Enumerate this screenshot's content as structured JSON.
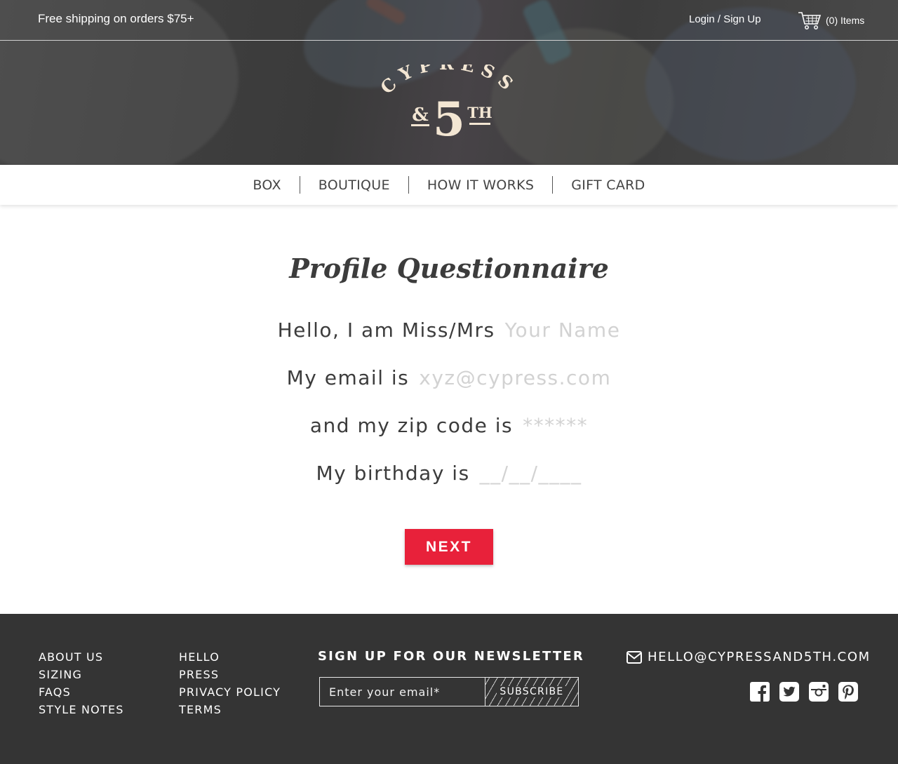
{
  "header": {
    "promo": "Free shipping on orders $75+",
    "login": "Login / Sign Up",
    "cart_count": "(0) Items"
  },
  "logo": {
    "top": "CYPRESS",
    "amp": "&",
    "five": "5",
    "th": "TH"
  },
  "nav": {
    "items": [
      "BOX",
      "BOUTIQUE",
      "HOW IT WORKS",
      "GIFT CARD"
    ]
  },
  "form": {
    "title": "Profile Questionnaire",
    "fields": [
      {
        "label": "Hello, I am Miss/Mrs",
        "placeholder": "Your Name"
      },
      {
        "label": "My email is",
        "placeholder": "xyz@cypress.com"
      },
      {
        "label": "and my zip code is",
        "placeholder": "******"
      },
      {
        "label": "My birthday is",
        "placeholder": "__/__/____"
      }
    ],
    "next_label": "NEXT"
  },
  "footer": {
    "col1": [
      "ABOUT US",
      "SIZING",
      "FAQS",
      "STYLE NOTES"
    ],
    "col2": [
      "HELLO",
      "PRESS",
      "PRIVACY POLICY",
      "TERMS"
    ],
    "newsletter_title": "SIGN UP FOR OUR NEWSLETTER",
    "newsletter_placeholder": "Enter your email*",
    "subscribe_label": "SUBSCRIBE",
    "email": "HELLO@CYPRESSAND5TH.COM",
    "social_icons": [
      "facebook-icon",
      "twitter-icon",
      "instagram-icon",
      "pinterest-icon"
    ]
  },
  "colors": {
    "accent": "#e8213a",
    "footer_bg": "#343434",
    "logo": "#f3e6d3"
  }
}
